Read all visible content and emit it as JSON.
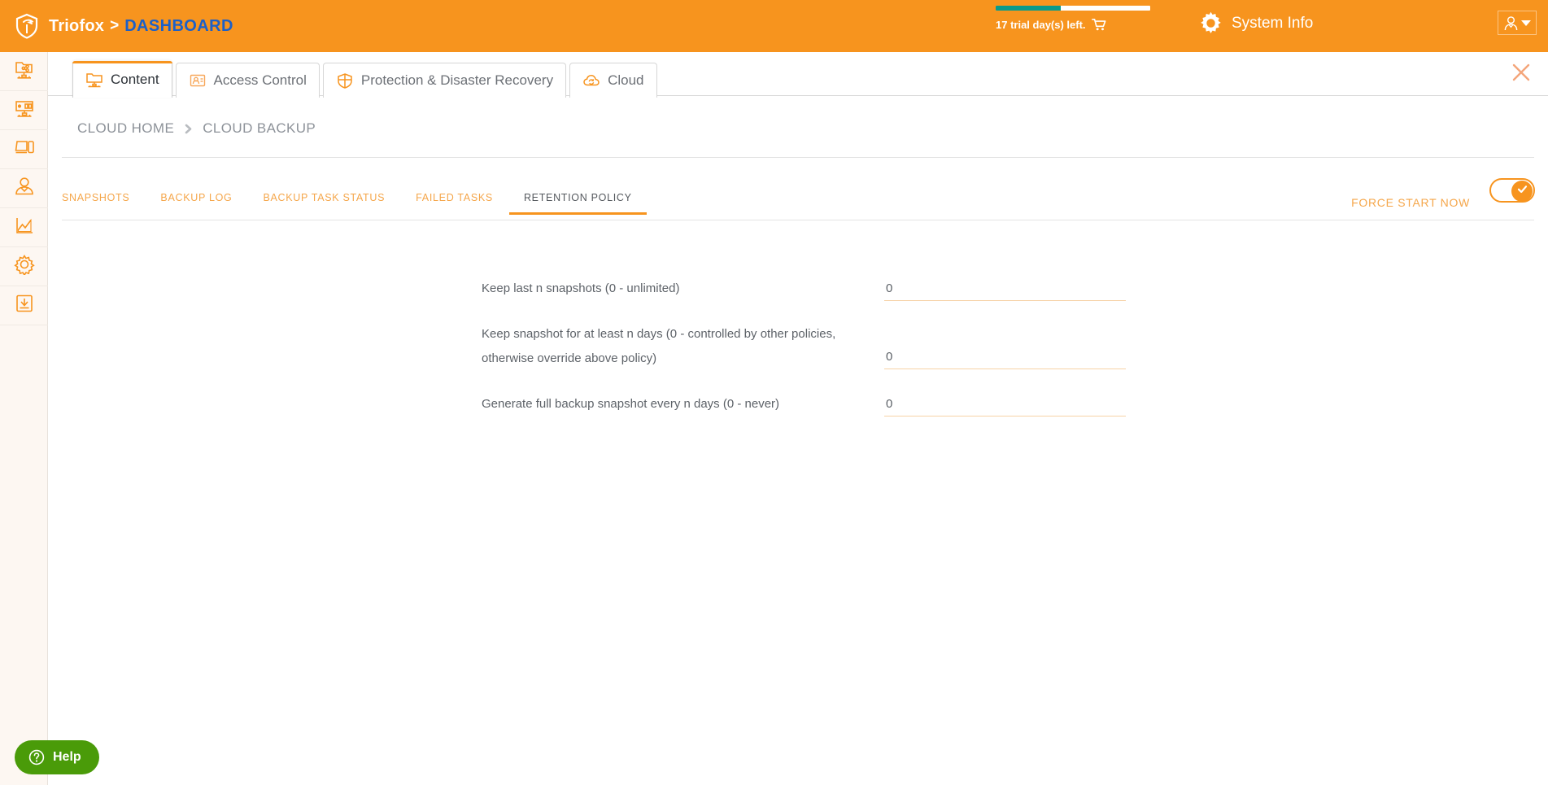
{
  "header": {
    "brand_name": "Triofox",
    "separator": ">",
    "page_title": "DASHBOARD",
    "logo_icon": "shield-logo-icon",
    "trial": {
      "text": "17 trial day(s) left.",
      "progress_percent": 42,
      "bar_fill_color": "#089a8a",
      "cart_icon": "shopping-cart-icon"
    },
    "system_info": {
      "label": "System Info",
      "icon": "gear-icon"
    },
    "user_menu": {
      "icon": "user-avatar-icon",
      "caret": "chevron-down-icon"
    },
    "background_color": "#f7941e",
    "page_title_color": "#1c60c8"
  },
  "sidebar": {
    "items": [
      {
        "name": "shared-folder-icon",
        "label": "Shared Folders"
      },
      {
        "name": "dashboard-monitor-icon",
        "label": "Dashboard"
      },
      {
        "name": "devices-icon",
        "label": "Devices"
      },
      {
        "name": "user-icon",
        "label": "Users"
      },
      {
        "name": "reports-chart-icon",
        "label": "Reports"
      },
      {
        "name": "settings-gear-icon",
        "label": "Settings"
      },
      {
        "name": "download-icon",
        "label": "Downloads"
      }
    ]
  },
  "tabs": [
    {
      "label": "Content",
      "icon": "content-folder-icon",
      "active": true
    },
    {
      "label": "Access Control",
      "icon": "access-control-icon",
      "active": false
    },
    {
      "label": "Protection & Disaster Recovery",
      "icon": "shield-protection-icon",
      "active": false
    },
    {
      "label": "Cloud",
      "icon": "cloud-sync-icon",
      "active": false
    }
  ],
  "close_button": {
    "icon": "close-icon"
  },
  "breadcrumb": {
    "items": [
      "CLOUD HOME",
      "CLOUD BACKUP"
    ],
    "separator_icon": "chevron-right-icon"
  },
  "subtabs": [
    {
      "label": "SNAPSHOTS",
      "active": false
    },
    {
      "label": "BACKUP LOG",
      "active": false
    },
    {
      "label": "BACKUP TASK STATUS",
      "active": false
    },
    {
      "label": "FAILED TASKS",
      "active": false
    },
    {
      "label": "RETENTION POLICY",
      "active": true
    }
  ],
  "actions": {
    "force_start_label": "FORCE START NOW",
    "toggle": {
      "name": "enable-toggle",
      "state": "on",
      "icon": "check-icon",
      "accent_color": "#f7941e"
    }
  },
  "form": {
    "rows": [
      {
        "label": "Keep last n snapshots (0 - unlimited)",
        "value": "0",
        "placeholder": "0",
        "name": "keep-last-n-snapshots-input"
      },
      {
        "label": "Keep snapshot for at least n days (0 - controlled by other policies, otherwise override above policy)",
        "value": "0",
        "placeholder": "0",
        "name": "keep-snapshot-days-input"
      },
      {
        "label": "Generate full backup snapshot every n days (0 - never)",
        "value": "0",
        "placeholder": "0",
        "name": "generate-full-backup-days-input"
      }
    ]
  },
  "help": {
    "label": "Help",
    "icon": "question-mark-icon",
    "background_color": "#4a9b09"
  }
}
